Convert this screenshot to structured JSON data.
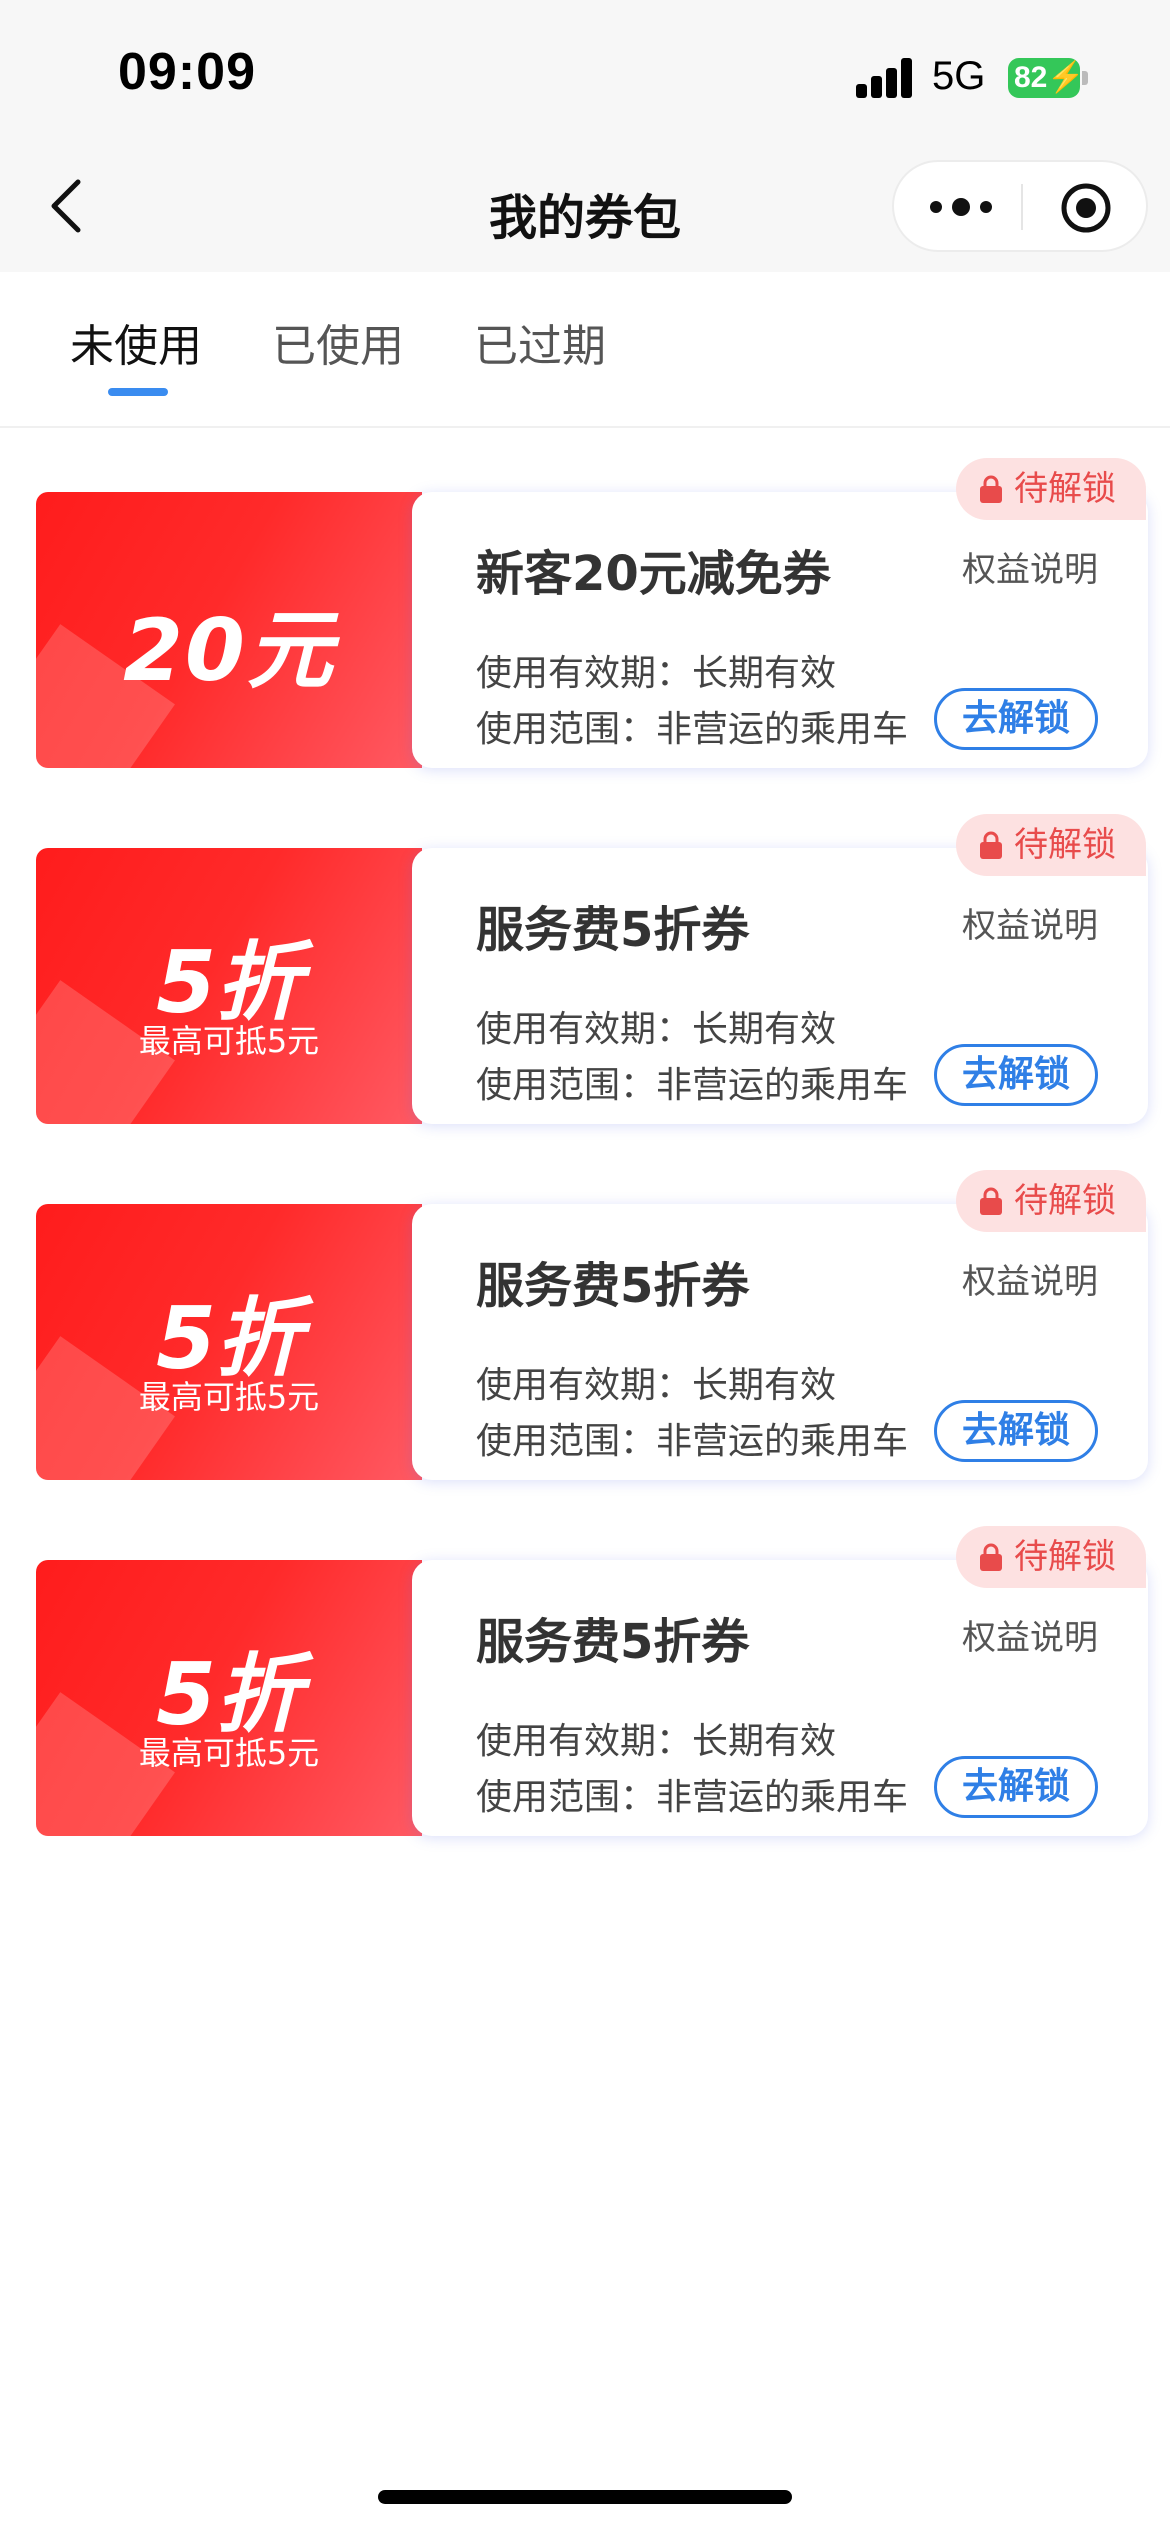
{
  "status_bar": {
    "time": "09:09",
    "network": "5G",
    "battery": "82"
  },
  "nav": {
    "title": "我的券包"
  },
  "tabs": [
    {
      "label": "未使用",
      "active": true
    },
    {
      "label": "已使用",
      "active": false
    },
    {
      "label": "已过期",
      "active": false
    }
  ],
  "coupons": [
    {
      "value_text": "20元",
      "sub_text": "",
      "title": "新客20元减免券",
      "desc_link": "权益说明",
      "validity": "使用有效期：长期有效",
      "scope": "使用范围：非营运的乘用车",
      "status": "待解锁",
      "action": "去解锁"
    },
    {
      "value_text": "5折",
      "sub_text": "最高可抵5元",
      "title": "服务费5折券",
      "desc_link": "权益说明",
      "validity": "使用有效期：长期有效",
      "scope": "使用范围：非营运的乘用车",
      "status": "待解锁",
      "action": "去解锁"
    },
    {
      "value_text": "5折",
      "sub_text": "最高可抵5元",
      "title": "服务费5折券",
      "desc_link": "权益说明",
      "validity": "使用有效期：长期有效",
      "scope": "使用范围：非营运的乘用车",
      "status": "待解锁",
      "action": "去解锁"
    },
    {
      "value_text": "5折",
      "sub_text": "最高可抵5元",
      "title": "服务费5折券",
      "desc_link": "权益说明",
      "validity": "使用有效期：长期有效",
      "scope": "使用范围：非营运的乘用车",
      "status": "待解锁",
      "action": "去解锁"
    }
  ],
  "colors": {
    "accent_blue": "#2f7fe6",
    "coupon_red": "#ff1c1c",
    "badge_text": "#e84b4b",
    "badge_bg": "#fde1e1"
  }
}
